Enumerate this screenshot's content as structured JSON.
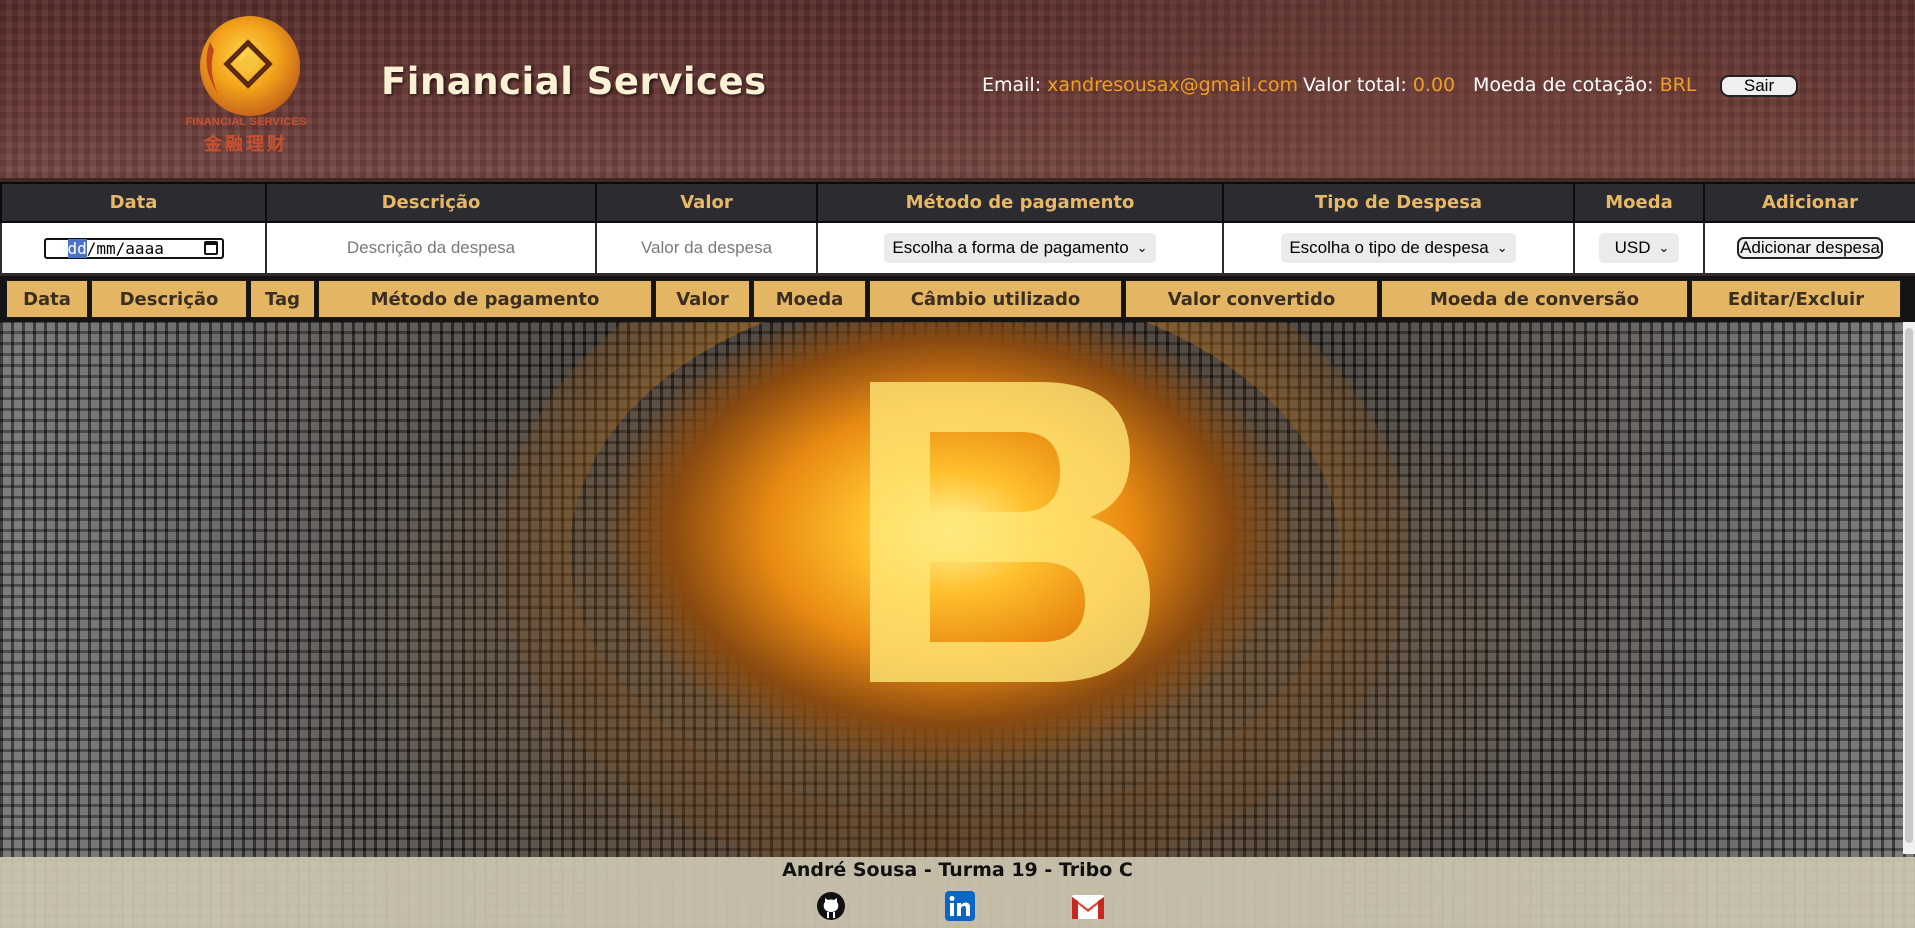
{
  "header": {
    "logo": {
      "text_en": "FINANCIAL SERVICES",
      "text_cn": "金融理财",
      "icon": "financial-services-logo"
    },
    "title": "Financial Services",
    "email_label": "Email:",
    "email": "xandresousax@gmail.com",
    "total_label": "Valor total:",
    "total": "0.00",
    "currency_label": "Moeda de cotação:",
    "currency": "BRL",
    "logout_label": "Sair"
  },
  "form": {
    "columns": [
      "Data",
      "Descrição",
      "Valor",
      "Método de pagamento",
      "Tipo de Despesa",
      "Moeda",
      "Adicionar"
    ],
    "date_placeholder_day": "dd",
    "date_placeholder_rest": "/mm/aaaa",
    "description_placeholder": "Descrição da despesa",
    "value_placeholder": "Valor da despesa",
    "payment_select": "Escolha a forma de pagamento",
    "type_select": "Escolha o tipo de despesa",
    "currency_select": "USD",
    "add_button": "Adicionar despesa"
  },
  "expenses": {
    "columns": [
      "Data",
      "Descrição",
      "Tag",
      "Método de pagamento",
      "Valor",
      "Moeda",
      "Câmbio utilizado",
      "Valor convertido",
      "Moeda de conversão",
      "Editar/Excluir"
    ],
    "rows": []
  },
  "footer": {
    "credit": "André Sousa - Turma 19 - Tribo C",
    "links": [
      "github-icon",
      "linkedin-icon",
      "gmail-icon"
    ]
  },
  "colors": {
    "accent": "#f0a020",
    "table_header_bg": "#e4b563",
    "form_header_bg": "#2b2b30",
    "form_header_text": "#e8b865"
  }
}
